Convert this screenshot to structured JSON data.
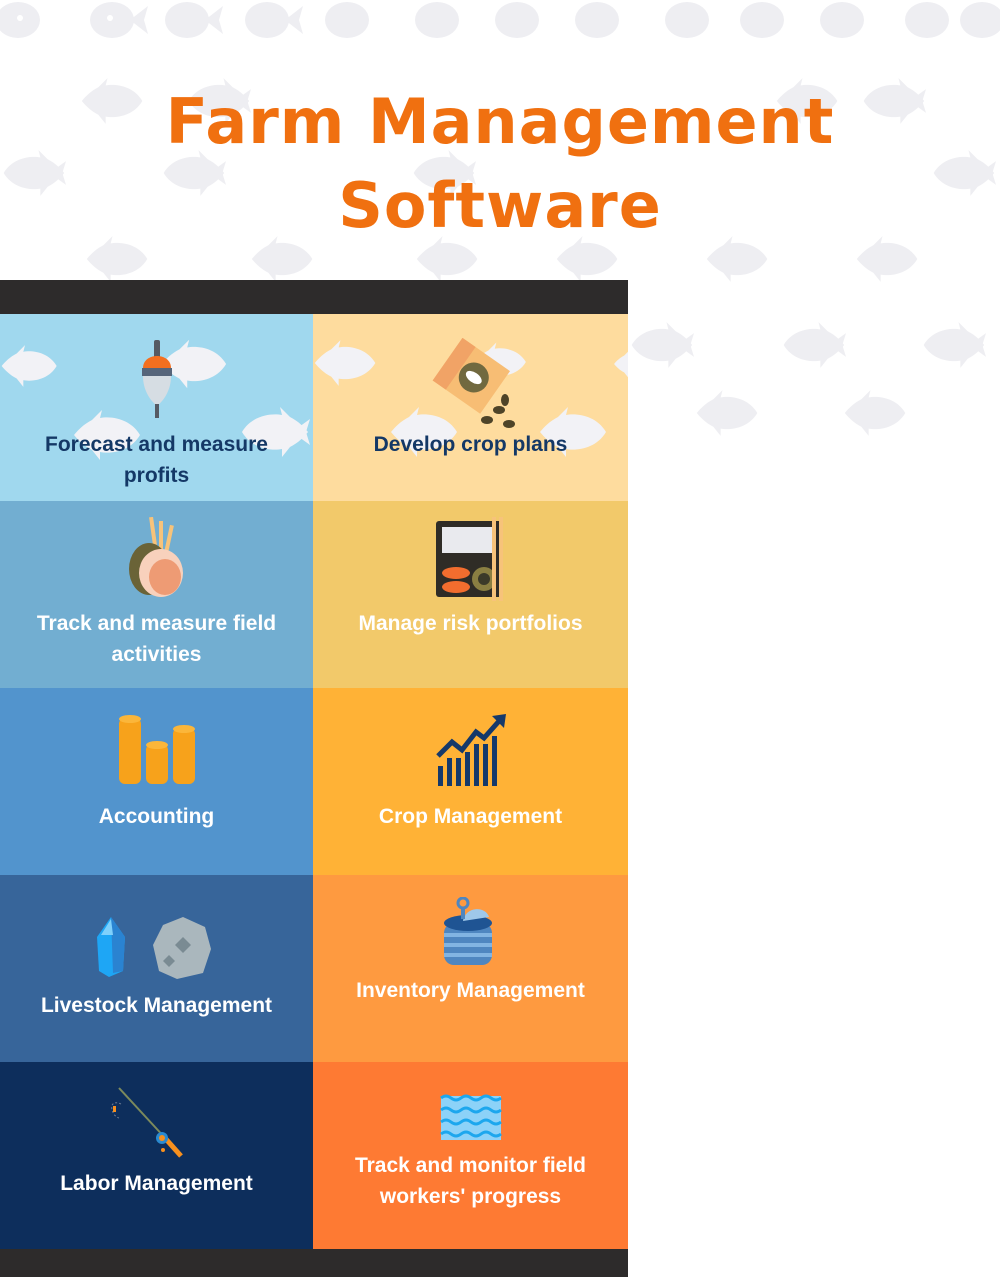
{
  "title": {
    "line1": "Farm Management",
    "line2": "Software"
  },
  "colors": {
    "title": "#f07010",
    "panel_frame": "#2d2b2b",
    "label_dark": "#143866",
    "label_light": "#ffffff"
  },
  "features": [
    {
      "label": "Forecast and measure profits",
      "icon": "fishing-float-icon",
      "bg": "#a0d8ee",
      "label_color": "dark"
    },
    {
      "label": "Develop crop plans",
      "icon": "seed-bag-icon",
      "bg": "#fedc9e",
      "label_color": "dark"
    },
    {
      "label": "Track and measure field activities",
      "icon": "meat-rack-icon",
      "bg": "#72aed1",
      "label_color": "light"
    },
    {
      "label": "Manage risk portfolios",
      "icon": "bento-box-icon",
      "bg": "#f2c96a",
      "label_color": "light"
    },
    {
      "label": "Accounting",
      "icon": "coin-stacks-icon",
      "bg": "#5294cd",
      "label_color": "light"
    },
    {
      "label": "Crop Management",
      "icon": "growth-chart-icon",
      "bg": "#ffb236",
      "label_color": "light"
    },
    {
      "label": "Livestock Management",
      "icon": "crystal-and-rock-icon",
      "bg": "#37659a",
      "label_color": "light"
    },
    {
      "label": "Inventory Management",
      "icon": "tin-can-icon",
      "bg": "#fe9a40",
      "label_color": "light"
    },
    {
      "label": "Labor Management",
      "icon": "fishing-rod-icon",
      "bg": "#0d2e5c",
      "label_color": "light"
    },
    {
      "label": "Track and monitor field workers' progress",
      "icon": "water-waves-icon",
      "bg": "#fe7a33",
      "label_color": "light"
    }
  ]
}
